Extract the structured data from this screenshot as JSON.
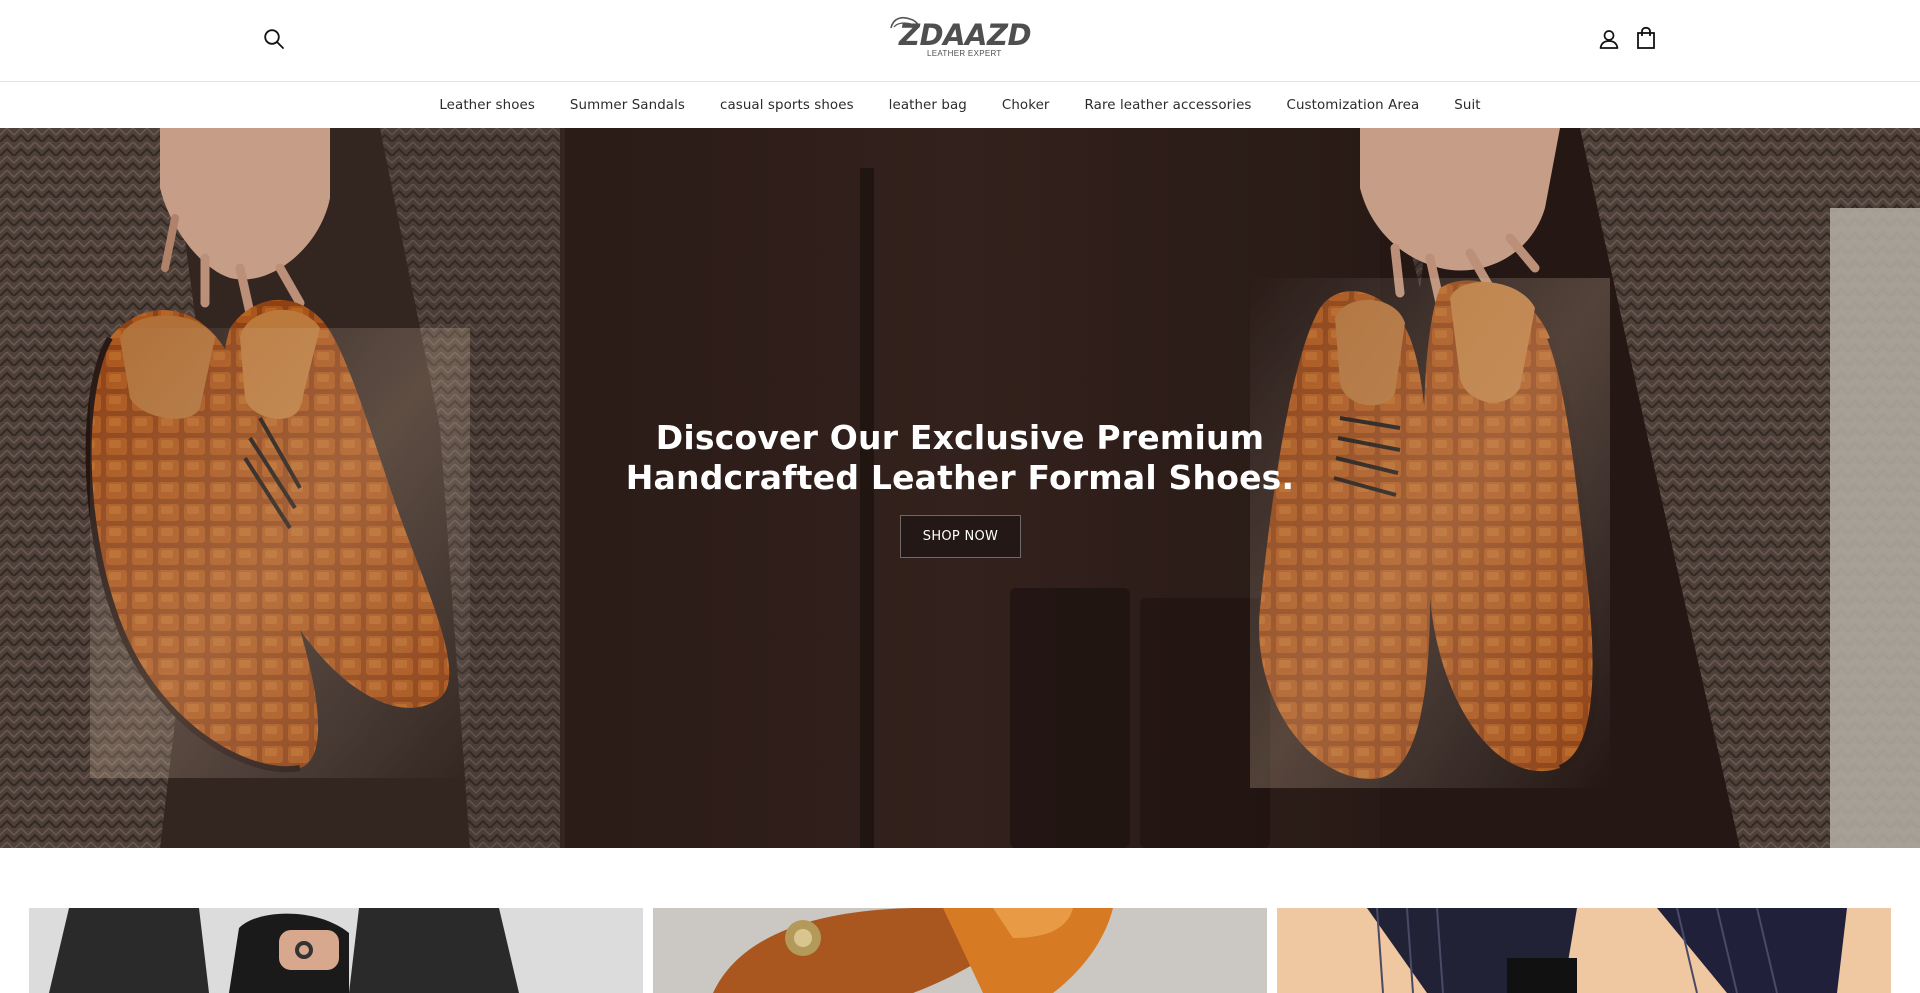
{
  "brand": {
    "name": "ZDAAZD",
    "tagline": "LEATHER EXPERT"
  },
  "header": {
    "icons": [
      "search-icon",
      "account-icon",
      "cart-icon"
    ]
  },
  "nav": {
    "items": [
      {
        "label": "Leather shoes"
      },
      {
        "label": "Summer Sandals"
      },
      {
        "label": "casual sports shoes"
      },
      {
        "label": "leather bag"
      },
      {
        "label": "Choker"
      },
      {
        "label": "Rare leather accessories"
      },
      {
        "label": "Customization Area"
      },
      {
        "label": "Suit"
      }
    ]
  },
  "hero": {
    "title_line1": "Discover Our Exclusive Premium",
    "title_line2": "Handcrafted Leather Formal Shoes.",
    "button_label": "SHOP NOW"
  },
  "colors": {
    "text": "#121212",
    "border": "#e4e4e4",
    "leather": "#8b3e14",
    "hero_bg": "#2a1c18"
  }
}
